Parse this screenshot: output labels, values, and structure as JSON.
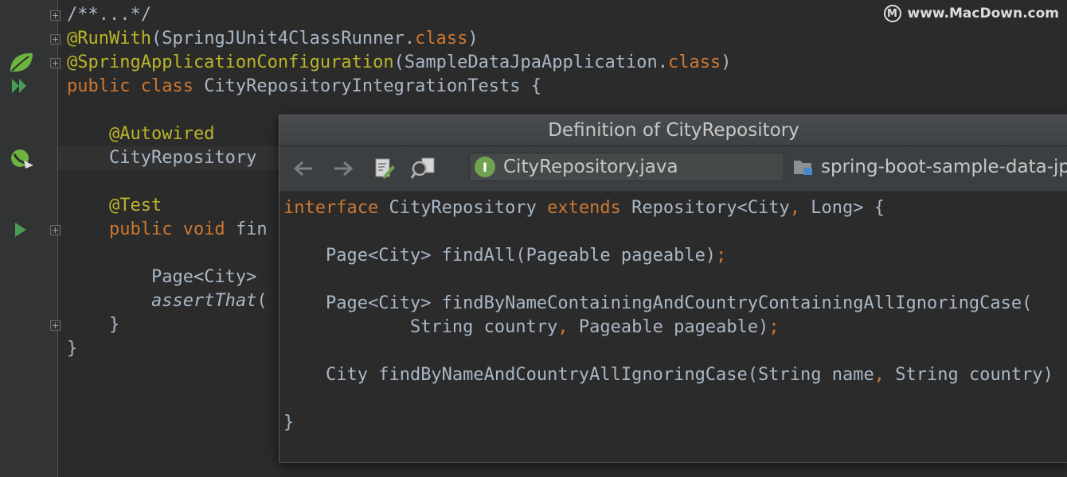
{
  "watermark": {
    "logo_glyph": "M",
    "text": "www.MacDown.com"
  },
  "editor": {
    "lines": [
      {
        "indent": "",
        "parts": [
          {
            "cls": "",
            "text": "/**...*/"
          }
        ]
      },
      {
        "indent": "",
        "parts": [
          {
            "cls": "ann",
            "text": "@RunWith"
          },
          {
            "cls": "",
            "text": "(SpringJUnit4ClassRunner."
          },
          {
            "cls": "kw",
            "text": "class"
          },
          {
            "cls": "",
            "text": ")"
          }
        ]
      },
      {
        "indent": "",
        "parts": [
          {
            "cls": "ann",
            "text": "@SpringApplicationConfiguration"
          },
          {
            "cls": "",
            "text": "(SampleDataJpaApplication."
          },
          {
            "cls": "kw",
            "text": "class"
          },
          {
            "cls": "",
            "text": ")"
          }
        ]
      },
      {
        "indent": "",
        "parts": [
          {
            "cls": "kw",
            "text": "public class "
          },
          {
            "cls": "",
            "text": "CityRepositoryIntegrationTests {"
          }
        ]
      },
      {
        "indent": "",
        "parts": []
      },
      {
        "indent": "    ",
        "parts": [
          {
            "cls": "ann",
            "text": "@Autowired"
          }
        ]
      },
      {
        "indent": "    ",
        "parts": [
          {
            "cls": "",
            "text": "CityRepository "
          }
        ]
      },
      {
        "indent": "",
        "parts": []
      },
      {
        "indent": "    ",
        "parts": [
          {
            "cls": "ann",
            "text": "@Test"
          }
        ]
      },
      {
        "indent": "    ",
        "parts": [
          {
            "cls": "kw",
            "text": "public void "
          },
          {
            "cls": "",
            "text": "fin"
          }
        ]
      },
      {
        "indent": "",
        "parts": []
      },
      {
        "indent": "        ",
        "parts": [
          {
            "cls": "",
            "text": "Page<City> "
          }
        ]
      },
      {
        "indent": "        ",
        "parts": [
          {
            "cls": "it",
            "text": "assertThat"
          },
          {
            "cls": "",
            "text": "("
          }
        ]
      },
      {
        "indent": "    ",
        "parts": [
          {
            "cls": "",
            "text": "}"
          }
        ]
      },
      {
        "indent": "",
        "parts": [
          {
            "cls": "",
            "text": "}"
          }
        ]
      }
    ]
  },
  "gutter_icons": {
    "spring": "spring-leaf-icon",
    "run_all": "run-all-tests-icon",
    "autowired": "autowired-bean-icon",
    "run_test": "run-test-icon"
  },
  "popup": {
    "title": "Definition of CityRepository",
    "toolbar": {
      "back": "back-icon",
      "forward": "forward-icon",
      "edit": "edit-source-icon",
      "find_usages": "find-usages-icon"
    },
    "file_name": "CityRepository.java",
    "file_icon_letter": "I",
    "module_name": "spring-boot-sample-data-jpa",
    "code": [
      {
        "indent": "",
        "parts": [
          {
            "cls": "kw",
            "text": "interface "
          },
          {
            "cls": "",
            "text": "CityRepository "
          },
          {
            "cls": "kw",
            "text": "extends "
          },
          {
            "cls": "",
            "text": "Repository<City"
          },
          {
            "cls": "kw",
            "text": ", "
          },
          {
            "cls": "",
            "text": "Long> {"
          }
        ]
      },
      {
        "indent": "",
        "parts": []
      },
      {
        "indent": "    ",
        "parts": [
          {
            "cls": "",
            "text": "Page<City> findAll(Pageable pageable)"
          },
          {
            "cls": "kw",
            "text": ";"
          }
        ]
      },
      {
        "indent": "",
        "parts": []
      },
      {
        "indent": "    ",
        "parts": [
          {
            "cls": "",
            "text": "Page<City> findByNameContainingAndCountryContainingAllIgnoringCase("
          }
        ]
      },
      {
        "indent": "            ",
        "parts": [
          {
            "cls": "",
            "text": "String country"
          },
          {
            "cls": "kw",
            "text": ", "
          },
          {
            "cls": "",
            "text": "Pageable pageable)"
          },
          {
            "cls": "kw",
            "text": ";"
          }
        ]
      },
      {
        "indent": "",
        "parts": []
      },
      {
        "indent": "    ",
        "parts": [
          {
            "cls": "",
            "text": "City findByNameAndCountryAllIgnoringCase(String name"
          },
          {
            "cls": "kw",
            "text": ", "
          },
          {
            "cls": "",
            "text": "String country)"
          }
        ]
      },
      {
        "indent": "",
        "parts": []
      },
      {
        "indent": "",
        "parts": [
          {
            "cls": "",
            "text": "}"
          }
        ]
      }
    ]
  }
}
